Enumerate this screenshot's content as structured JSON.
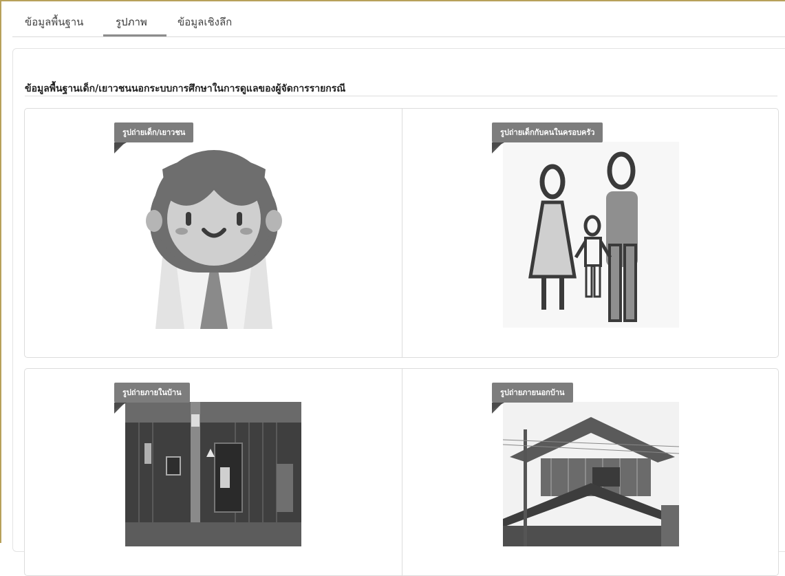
{
  "tabs": [
    {
      "label": "ข้อมูลพื้นฐาน"
    },
    {
      "label": "รูปภาพ"
    },
    {
      "label": "ข้อมูลเชิงลึก"
    }
  ],
  "section_title": "ข้อมูลพื้นฐานเด็ก/เยาวชนนอกระบบการศึกษาในการดูแลของผู้จัดการรายกรณี",
  "photos": [
    {
      "label": "รูปถ่ายเด็ก/เยาวชน",
      "icon": "child-avatar-icon"
    },
    {
      "label": "รูปถ่ายเด็กกับคนในครอบครัว",
      "icon": "family-icon"
    },
    {
      "label": "รูปถ่ายภายในบ้าน",
      "icon": "house-interior-photo"
    },
    {
      "label": "รูปถ่ายภายนอกบ้าน",
      "icon": "house-exterior-photo"
    }
  ],
  "colors": {
    "frame": "#b8a15a",
    "ribbon": "#7d7d7d",
    "active_tab_underline": "#8c8c8c"
  }
}
